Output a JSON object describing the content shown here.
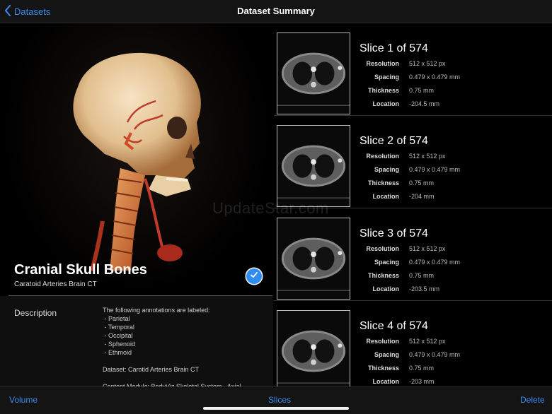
{
  "navbar": {
    "back_label": "Datasets",
    "title": "Dataset Summary"
  },
  "hero": {
    "title": "Cranial Skull Bones",
    "subtitle": "Caratoid Arteries Brain CT",
    "selected": true
  },
  "description": {
    "label": "Description",
    "text": "The following annotations are labeled:\n - Parietal\n - Temporal\n - Occipital\n - Sphenoid\n - Ethmoid\n\nDataset: Carotid Arteries Brain CT\n\nContent Module: BodyViz Skeletal System - Axial"
  },
  "slices": {
    "items": [
      {
        "title": "Slice 1 of 574",
        "resolution": "512 x 512 px",
        "spacing": "0.479 x 0.479 mm",
        "thickness": "0.75 mm",
        "location": "-204.5 mm"
      },
      {
        "title": "Slice 2 of 574",
        "resolution": "512 x 512 px",
        "spacing": "0.479 x 0.479 mm",
        "thickness": "0.75 mm",
        "location": "-204 mm"
      },
      {
        "title": "Slice 3 of 574",
        "resolution": "512 x 512 px",
        "spacing": "0.479 x 0.479 mm",
        "thickness": "0.75 mm",
        "location": "-203.5 mm"
      },
      {
        "title": "Slice 4 of 574",
        "resolution": "512 x 512 px",
        "spacing": "0.479 x 0.479 mm",
        "thickness": "0.75 mm",
        "location": "-203 mm"
      }
    ],
    "labels": {
      "resolution": "Resolution",
      "spacing": "Spacing",
      "thickness": "Thickness",
      "location": "Location"
    }
  },
  "watermark": "UpdateStar.com",
  "toolbar": {
    "volume_label": "Volume",
    "slices_label": "Slices",
    "delete_label": "Delete"
  },
  "colors": {
    "accent": "#3a8cf0",
    "background": "#000000",
    "bar": "#141414"
  },
  "icons": {
    "back": "chevron-left-icon",
    "check": "checkmark-circle-icon"
  }
}
